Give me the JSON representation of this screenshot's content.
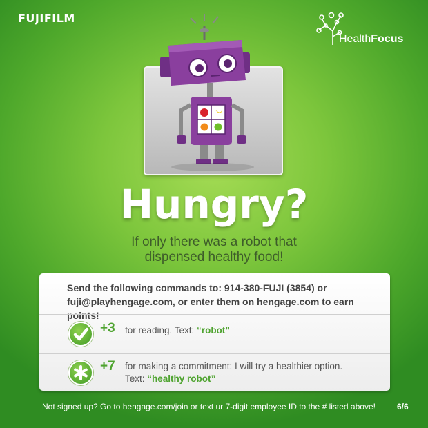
{
  "brand": {
    "company": "FUJIFILM",
    "program_light": "Health",
    "program_bold": "Focus"
  },
  "headline": "Hungry?",
  "subline": {
    "line1": "If only there was a robot that",
    "line2": "dispensed healthy food!"
  },
  "instructions": {
    "line1": "Send the following commands to: 914-380-FUJI (3854) or",
    "line2": "fuji@playhengage.com, or enter them on hengage.com to earn points!"
  },
  "actions": [
    {
      "icon": "checkmark-icon",
      "points": "+3",
      "text": "for reading. Text: ",
      "keyword": "“robot”"
    },
    {
      "icon": "asterisk-icon",
      "points": "+7",
      "text": "for making a commitment: I will try a healthier option.",
      "text2": "Text: ",
      "keyword": "“healthy robot”"
    }
  ],
  "footer": "Not signed up? Go to hengage.com/join or text ur 7-digit employee ID to the # listed above!",
  "page_indicator": "6/6",
  "colors": {
    "background_green": "#7dc63c",
    "accent_green": "#4ea32f",
    "robot_purple": "#8a3f9e",
    "card_gray": "#cfcfcf",
    "subline_text": "#3e5d2a"
  }
}
